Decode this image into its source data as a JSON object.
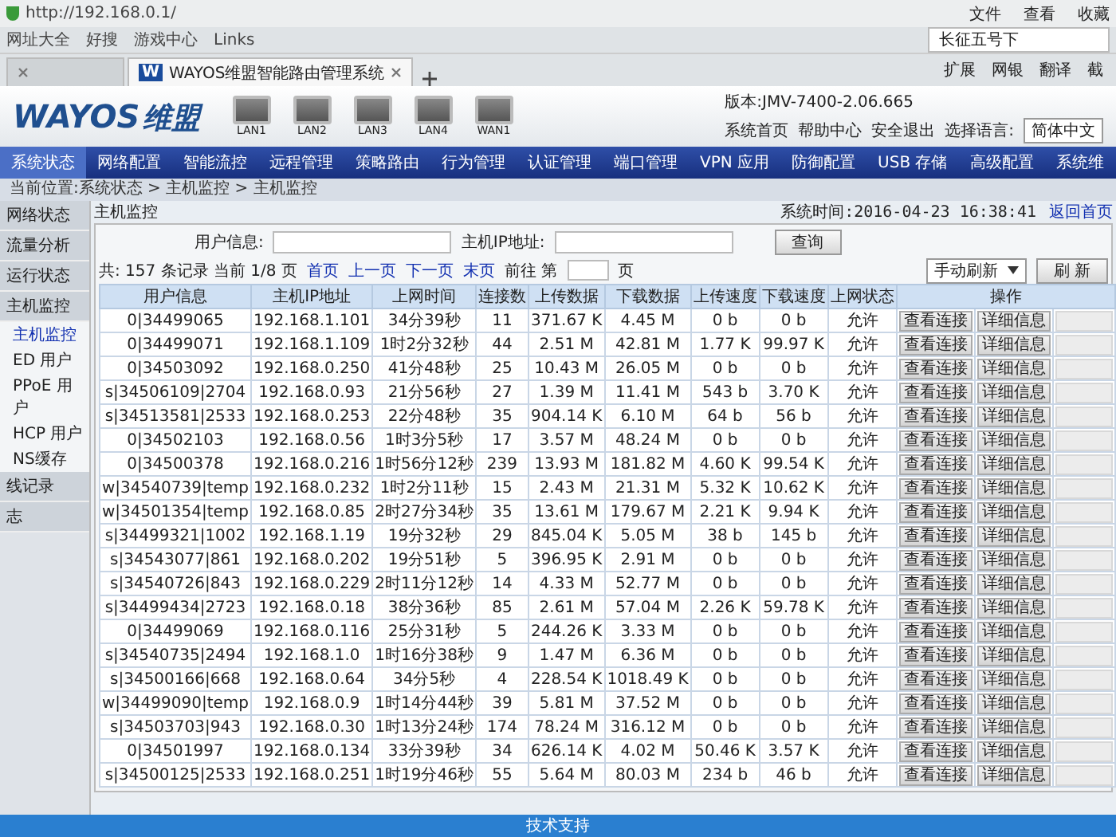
{
  "browser": {
    "address": "http://192.168.0.1/",
    "menu": [
      "文件",
      "查看",
      "收藏"
    ],
    "bookmarks": [
      "网址大全",
      "好搜",
      "游戏中心",
      "Links"
    ],
    "search": {
      "value": "长征五号下"
    },
    "tabs": [
      {
        "selected": false
      },
      {
        "favicon": "W",
        "label": "WAYOS维盟智能路由管理系统",
        "selected": true
      }
    ],
    "extensions": [
      "扩展",
      "网银",
      "翻译",
      "截"
    ]
  },
  "header": {
    "logo": "WAYOS",
    "logo_cn": "维盟",
    "ports": [
      "LAN1",
      "LAN2",
      "LAN3",
      "LAN4",
      "WAN1"
    ],
    "version": "版本:JMV-7400-2.06.665",
    "links": [
      "系统首页",
      "帮助中心",
      "安全退出"
    ],
    "language_label": "选择语言:",
    "language": "简体中文"
  },
  "nav": [
    {
      "label": "系统状态",
      "selected": true
    },
    {
      "label": "网络配置",
      "selected": false
    },
    {
      "label": "智能流控",
      "selected": false
    },
    {
      "label": "远程管理",
      "selected": false
    },
    {
      "label": "策略路由",
      "selected": false
    },
    {
      "label": "行为管理",
      "selected": false
    },
    {
      "label": "认证管理",
      "selected": false
    },
    {
      "label": "端口管理",
      "selected": false
    },
    {
      "label": "VPN 应用",
      "selected": false
    },
    {
      "label": "防御配置",
      "selected": false
    },
    {
      "label": "USB 存储",
      "selected": false
    },
    {
      "label": "高级配置",
      "selected": false
    },
    {
      "label": "系统维",
      "selected": false
    }
  ],
  "breadcrumb": "当前位置:系统状态 > 主机监控 > 主机监控",
  "system_time": "系统时间:2016-04-23 16:38:41",
  "home_link": "返回首页",
  "sidebar": [
    {
      "label": "网络状态",
      "selected": false
    },
    {
      "label": "流量分析",
      "selected": false
    },
    {
      "label": "运行状态",
      "selected": false
    },
    {
      "label": "主机监控",
      "selected": false,
      "children": [
        {
          "label": "主机监控",
          "selected": true
        },
        {
          "label": "ED 用户",
          "selected": false
        },
        {
          "label": "PPoE 用户",
          "selected": false
        },
        {
          "label": "HCP 用户",
          "selected": false
        },
        {
          "label": "NS缓存",
          "selected": false
        }
      ]
    },
    {
      "label": "线记录",
      "selected": false
    },
    {
      "label": "志",
      "selected": false
    }
  ],
  "panel": {
    "title": "主机监控",
    "user_label": "用户信息:",
    "ip_label": "主机IP地址:",
    "query_button": "查询",
    "pager": {
      "summary": "共: 157 条记录 当前 1/8 页",
      "links": [
        "首页",
        "上一页",
        "下一页",
        "末页"
      ],
      "goto_label": "前往 第",
      "goto_suffix": "页"
    },
    "refresh_mode": "手动刷新",
    "refresh_button": "刷 新"
  },
  "table": {
    "columns": [
      "用户信息",
      "主机IP地址",
      "上网时间",
      "连接数",
      "上传数据",
      "下载数据",
      "上传速度",
      "下载速度",
      "上网状态",
      "操作"
    ],
    "rows": [
      {
        "cells": [
          "0|34499065",
          "192.168.1.101",
          "34分39秒",
          "11",
          "371.67 K",
          "4.45 M",
          "0 b",
          "0 b",
          "允许"
        ],
        "actions": [
          {
            "label": "查看连接",
            "disabled": false
          },
          {
            "label": "详细信息",
            "disabled": false
          },
          {
            "disabled": true
          }
        ]
      },
      {
        "cells": [
          "0|34499071",
          "192.168.1.109",
          "1时2分32秒",
          "44",
          "2.51 M",
          "42.81 M",
          "1.77 K",
          "99.97 K",
          "允许"
        ],
        "actions": [
          {
            "label": "查看连接",
            "disabled": false
          },
          {
            "label": "详细信息",
            "disabled": false
          },
          {
            "disabled": true
          }
        ]
      },
      {
        "cells": [
          "0|34503092",
          "192.168.0.250",
          "41分48秒",
          "25",
          "10.43 M",
          "26.05 M",
          "0 b",
          "0 b",
          "允许"
        ],
        "actions": [
          {
            "label": "查看连接",
            "disabled": false
          },
          {
            "label": "详细信息",
            "disabled": false
          },
          {
            "disabled": true
          }
        ]
      },
      {
        "cells": [
          "s|34506109|2704",
          "192.168.0.93",
          "21分56秒",
          "27",
          "1.39 M",
          "11.41 M",
          "543 b",
          "3.70 K",
          "允许"
        ],
        "actions": [
          {
            "label": "查看连接",
            "disabled": false
          },
          {
            "label": "详细信息",
            "disabled": false
          },
          {
            "disabled": true
          }
        ]
      },
      {
        "cells": [
          "s|34513581|2533",
          "192.168.0.253",
          "22分48秒",
          "35",
          "904.14 K",
          "6.10 M",
          "64 b",
          "56 b",
          "允许"
        ],
        "actions": [
          {
            "label": "查看连接",
            "disabled": false
          },
          {
            "label": "详细信息",
            "disabled": false
          },
          {
            "disabled": true
          }
        ]
      },
      {
        "cells": [
          "0|34502103",
          "192.168.0.56",
          "1时3分5秒",
          "17",
          "3.57 M",
          "48.24 M",
          "0 b",
          "0 b",
          "允许"
        ],
        "actions": [
          {
            "label": "查看连接",
            "disabled": false
          },
          {
            "label": "详细信息",
            "disabled": false
          },
          {
            "disabled": true
          }
        ]
      },
      {
        "cells": [
          "0|34500378",
          "192.168.0.216",
          "1时56分12秒",
          "239",
          "13.93 M",
          "181.82 M",
          "4.60 K",
          "99.54 K",
          "允许"
        ],
        "actions": [
          {
            "label": "查看连接",
            "disabled": false
          },
          {
            "label": "详细信息",
            "disabled": false
          },
          {
            "disabled": true
          }
        ]
      },
      {
        "cells": [
          "w|34540739|temp",
          "192.168.0.232",
          "1时2分11秒",
          "15",
          "2.43 M",
          "21.31 M",
          "5.32 K",
          "10.62 K",
          "允许"
        ],
        "actions": [
          {
            "label": "查看连接",
            "disabled": false
          },
          {
            "label": "详细信息",
            "disabled": false
          },
          {
            "disabled": true
          }
        ]
      },
      {
        "cells": [
          "w|34501354|temp",
          "192.168.0.85",
          "2时27分34秒",
          "35",
          "13.61 M",
          "179.67 M",
          "2.21 K",
          "9.94 K",
          "允许"
        ],
        "actions": [
          {
            "label": "查看连接",
            "disabled": false
          },
          {
            "label": "详细信息",
            "disabled": false
          },
          {
            "disabled": true
          }
        ]
      },
      {
        "cells": [
          "s|34499321|1002",
          "192.168.1.19",
          "19分32秒",
          "29",
          "845.04 K",
          "5.05 M",
          "38 b",
          "145 b",
          "允许"
        ],
        "actions": [
          {
            "label": "查看连接",
            "disabled": false
          },
          {
            "label": "详细信息",
            "disabled": false
          },
          {
            "disabled": true
          }
        ]
      },
      {
        "cells": [
          "s|34543077|861",
          "192.168.0.202",
          "19分51秒",
          "5",
          "396.95 K",
          "2.91 M",
          "0 b",
          "0 b",
          "允许"
        ],
        "actions": [
          {
            "label": "查看连接",
            "disabled": false
          },
          {
            "label": "详细信息",
            "disabled": false
          },
          {
            "disabled": true
          }
        ]
      },
      {
        "cells": [
          "s|34540726|843",
          "192.168.0.229",
          "2时11分12秒",
          "14",
          "4.33 M",
          "52.77 M",
          "0 b",
          "0 b",
          "允许"
        ],
        "actions": [
          {
            "label": "查看连接",
            "disabled": false
          },
          {
            "label": "详细信息",
            "disabled": false
          },
          {
            "disabled": true
          }
        ]
      },
      {
        "cells": [
          "s|34499434|2723",
          "192.168.0.18",
          "38分36秒",
          "85",
          "2.61 M",
          "57.04 M",
          "2.26 K",
          "59.78 K",
          "允许"
        ],
        "actions": [
          {
            "label": "查看连接",
            "disabled": false
          },
          {
            "label": "详细信息",
            "disabled": false
          },
          {
            "disabled": true
          }
        ]
      },
      {
        "cells": [
          "0|34499069",
          "192.168.0.116",
          "25分31秒",
          "5",
          "244.26 K",
          "3.33 M",
          "0 b",
          "0 b",
          "允许"
        ],
        "actions": [
          {
            "label": "查看连接",
            "disabled": false
          },
          {
            "label": "详细信息",
            "disabled": false
          },
          {
            "disabled": true
          }
        ]
      },
      {
        "cells": [
          "s|34540735|2494",
          "192.168.1.0",
          "1时16分38秒",
          "9",
          "1.47 M",
          "6.36 M",
          "0 b",
          "0 b",
          "允许"
        ],
        "actions": [
          {
            "label": "查看连接",
            "disabled": false
          },
          {
            "label": "详细信息",
            "disabled": false
          },
          {
            "disabled": true
          }
        ]
      },
      {
        "cells": [
          "s|34500166|668",
          "192.168.0.64",
          "34分5秒",
          "4",
          "228.54 K",
          "1018.49 K",
          "0 b",
          "0 b",
          "允许"
        ],
        "actions": [
          {
            "label": "查看连接",
            "disabled": false
          },
          {
            "label": "详细信息",
            "disabled": false
          },
          {
            "disabled": true
          }
        ]
      },
      {
        "cells": [
          "w|34499090|temp",
          "192.168.0.9",
          "1时14分44秒",
          "39",
          "5.81 M",
          "37.52 M",
          "0 b",
          "0 b",
          "允许"
        ],
        "actions": [
          {
            "label": "查看连接",
            "disabled": false
          },
          {
            "label": "详细信息",
            "disabled": false
          },
          {
            "disabled": true
          }
        ]
      },
      {
        "cells": [
          "s|34503703|943",
          "192.168.0.30",
          "1时13分24秒",
          "174",
          "78.24 M",
          "316.12 M",
          "0 b",
          "0 b",
          "允许"
        ],
        "actions": [
          {
            "label": "查看连接",
            "disabled": false
          },
          {
            "label": "详细信息",
            "disabled": false
          },
          {
            "disabled": true
          }
        ]
      },
      {
        "cells": [
          "0|34501997",
          "192.168.0.134",
          "33分39秒",
          "34",
          "626.14 K",
          "4.02 M",
          "50.46 K",
          "3.57 K",
          "允许"
        ],
        "actions": [
          {
            "label": "查看连接",
            "disabled": false
          },
          {
            "label": "详细信息",
            "disabled": false
          },
          {
            "disabled": true
          }
        ]
      },
      {
        "cells": [
          "s|34500125|2533",
          "192.168.0.251",
          "1时19分46秒",
          "55",
          "5.64 M",
          "80.03 M",
          "234 b",
          "46 b",
          "允许"
        ],
        "actions": [
          {
            "label": "查看连接",
            "disabled": false
          },
          {
            "label": "详细信息",
            "disabled": false
          },
          {
            "disabled": true
          }
        ]
      }
    ]
  },
  "footer": "技术支持"
}
